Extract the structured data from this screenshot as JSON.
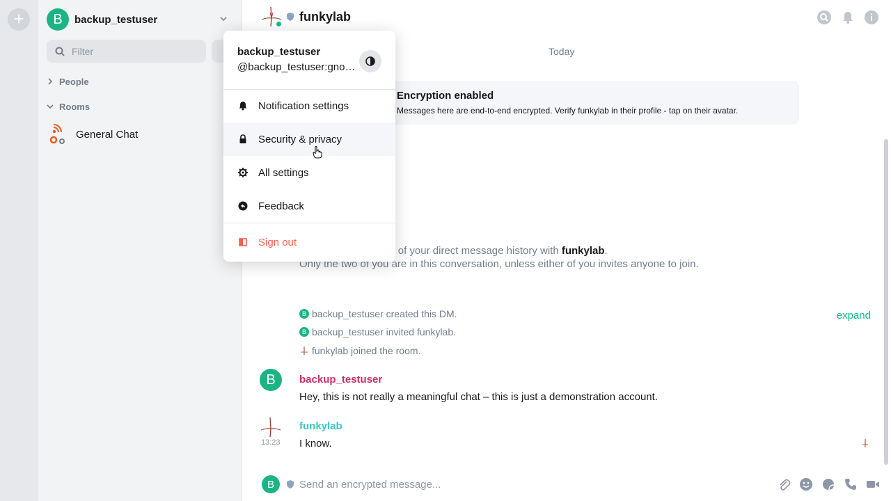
{
  "user": {
    "initial": "B",
    "display_name": "backup_testuser",
    "mxid": "@backup_testuser:gnome.org"
  },
  "sidebar": {
    "filter_placeholder": "Filter",
    "sections": [
      {
        "label": "People"
      },
      {
        "label": "Rooms"
      }
    ],
    "rooms": [
      {
        "label": "General Chat"
      }
    ]
  },
  "room": {
    "name": "funkylab",
    "date_separator": "Today",
    "encryption_title": "Encryption enabled",
    "encryption_desc": "Messages here are end-to-end encrypted. Verify funkylab in their profile - tap on their avatar.",
    "intro_prefix": "This is the beginning of your direct message history with ",
    "intro_name": "funkylab",
    "intro_suffix": ".",
    "intro_line2": "Only the two of you are in this conversation, unless either of you invites anyone to join.",
    "events": [
      {
        "text": "backup_testuser created this DM."
      },
      {
        "text": "backup_testuser invited funkylab."
      },
      {
        "text": "funkylab joined the room."
      }
    ],
    "expand_label": "expand",
    "messages": [
      {
        "sender": "backup_testuser",
        "body": "Hey, this is not really a meaningful chat – this is just a demonstration account.",
        "color": "#c9306a"
      },
      {
        "sender": "funkylab",
        "body": "I know.",
        "time": "13:23",
        "color": "#3fc7c1"
      }
    ],
    "composer_placeholder": "Send an encrypted message..."
  },
  "menu": {
    "items": [
      {
        "label": "Notification settings",
        "icon": "bell-icon"
      },
      {
        "label": "Security & privacy",
        "icon": "lock-icon"
      },
      {
        "label": "All settings",
        "icon": "gear-icon"
      },
      {
        "label": "Feedback",
        "icon": "feedback-icon"
      }
    ],
    "sign_out": "Sign out"
  },
  "colors": {
    "accent": "#0dbd8b",
    "danger": "#ff5b55",
    "avatar_green": "#1db485"
  }
}
